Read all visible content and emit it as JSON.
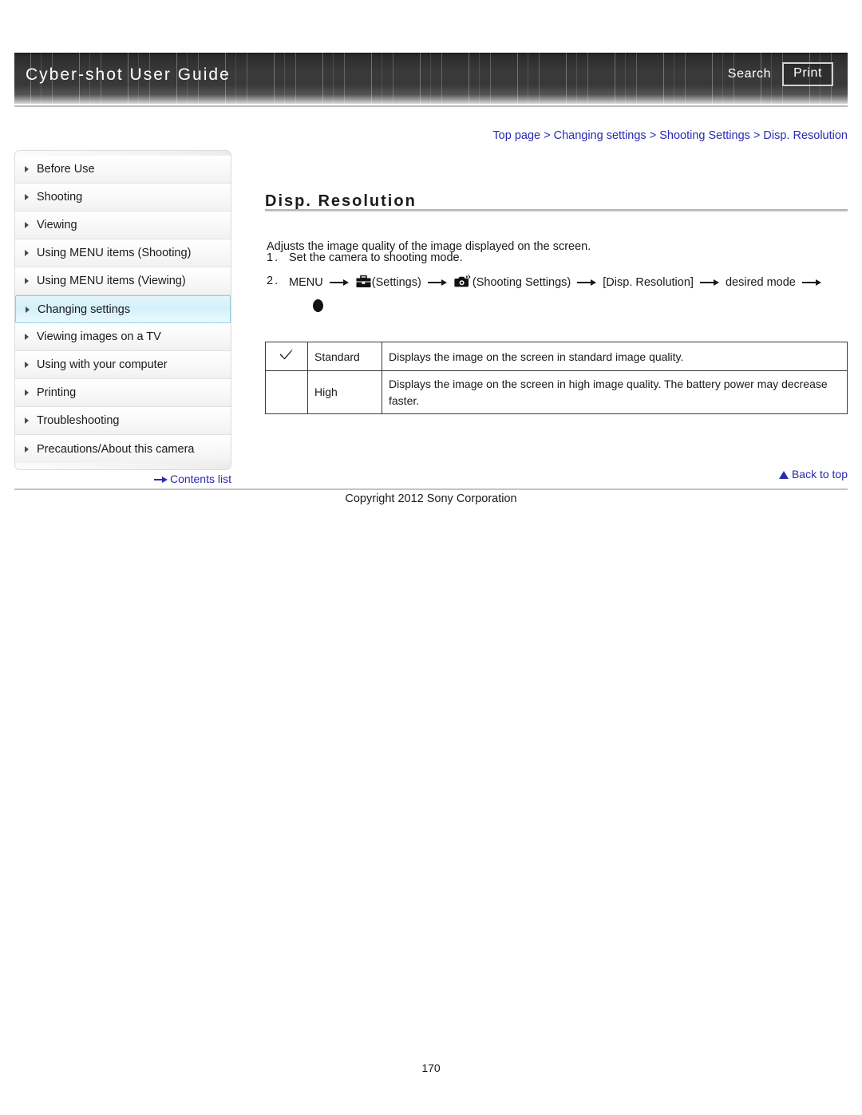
{
  "header": {
    "title": "Cyber-shot User Guide",
    "search_label": "Search",
    "print_label": "Print"
  },
  "breadcrumb": {
    "separator": ">",
    "items": [
      {
        "label": "Top page"
      },
      {
        "label": "Changing settings"
      },
      {
        "label": "Shooting Settings"
      },
      {
        "label": "Disp. Resolution"
      }
    ]
  },
  "sidebar": {
    "items": [
      {
        "label": "Before Use",
        "active": false
      },
      {
        "label": "Shooting",
        "active": false
      },
      {
        "label": "Viewing",
        "active": false
      },
      {
        "label": "Using MENU items (Shooting)",
        "active": false
      },
      {
        "label": "Using MENU items (Viewing)",
        "active": false
      },
      {
        "label": "Changing settings",
        "active": true
      },
      {
        "label": "Viewing images on a TV",
        "active": false
      },
      {
        "label": "Using with your computer",
        "active": false
      },
      {
        "label": "Printing",
        "active": false
      },
      {
        "label": "Troubleshooting",
        "active": false
      },
      {
        "label": "Precautions/About this camera",
        "active": false
      }
    ],
    "contents_list_label": "Contents list"
  },
  "main": {
    "title": "Disp. Resolution",
    "intro": "Adjusts the image quality of the image displayed on the screen.",
    "steps": [
      {
        "number": "1.",
        "text": "Set the camera to shooting mode."
      },
      {
        "number": "2.",
        "menu_label": "MENU",
        "settings_label": "(Settings)",
        "shooting_settings_label": "(Shooting Settings)",
        "item_label": "[Disp. Resolution]",
        "desired_mode_label": "desired mode"
      }
    ],
    "table": {
      "rows": [
        {
          "checked": true,
          "name": "Standard",
          "description": "Displays the image on the screen in standard image quality."
        },
        {
          "checked": false,
          "name": "High",
          "description": "Displays the image on the screen in high image quality. The battery power may decrease faster."
        }
      ]
    }
  },
  "footer": {
    "back_to_top_label": "Back to top",
    "copyright": "Copyright 2012 Sony Corporation",
    "page_number": "170"
  },
  "colors": {
    "link": "#2a2ab0",
    "active_nav_border": "#8ecfe4",
    "header_dark": "#303030"
  }
}
